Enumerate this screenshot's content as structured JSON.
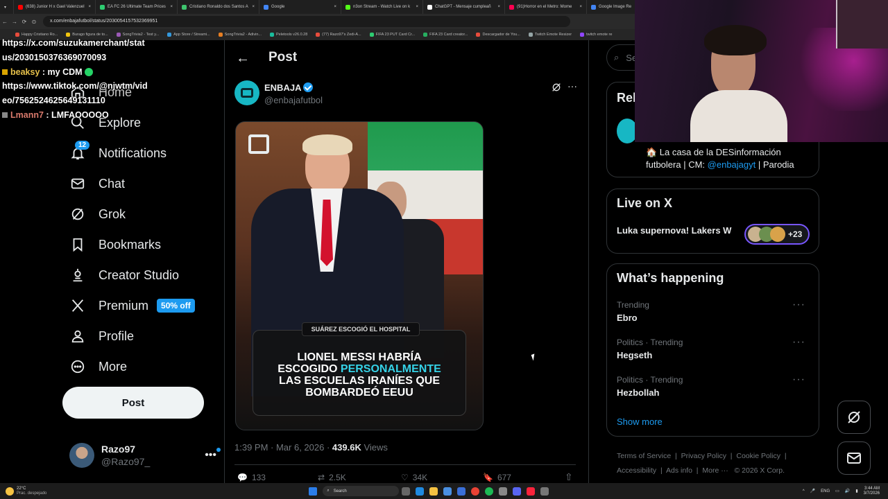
{
  "browser": {
    "tabs": [
      {
        "title": "(638) Junior H x Gael Valenzuel",
        "color": "#ff0000"
      },
      {
        "title": "EA FC 26 Ultimate Team Prices",
        "color": "#2ecc71"
      },
      {
        "title": "Cristiano Ronaldo dos Santos A",
        "color": "#3ec46d"
      },
      {
        "title": "Google",
        "color": "#4285f4"
      },
      {
        "title": "n3on Stream - Watch Live on k",
        "color": "#53fc18"
      },
      {
        "title": "ChatGPT - Mensaje cumpleañ",
        "color": "#ffffff"
      },
      {
        "title": "(91)Horror en el Metro: Mome",
        "color": "#ff0050"
      },
      {
        "title": "Google Image Re",
        "color": "#4285f4"
      }
    ],
    "url": "x.com/enbajafutbol/status/2030054157532369951",
    "bookmarks": [
      "Happy Cristiano Ro...",
      "Burago figura de to...",
      "SongTrivia2 - Test y...",
      "App Store / Streami...",
      "SongTrivia2 - Adivin...",
      "Peletools v26.0.28",
      "(77) Razo97's Zedi-A...",
      "FIFA 23 PUT Card Cr...",
      "FIFA 23 Card creator...",
      "Descargador de You...",
      "Twitch Emote Resizer",
      "twitch emote re"
    ]
  },
  "chat_overlay": [
    {
      "user": "",
      "text": "https://x.com/suzukamerchant/stat"
    },
    {
      "user": "",
      "text": "us/2030150376369070093"
    },
    {
      "user": "beaksy",
      "text": ": my CDM"
    },
    {
      "user": "",
      "text": "https://www.tiktok.com/@njwtm/vid"
    },
    {
      "user": "",
      "text": "eo/7562524625649131110"
    },
    {
      "user": "Lmann7",
      "text": ": LMFAOOOOO"
    }
  ],
  "nav": {
    "home": "Home",
    "explore": "Explore",
    "notifications": "Notifications",
    "notifications_badge": "12",
    "chat": "Chat",
    "grok": "Grok",
    "bookmarks": "Bookmarks",
    "creator_studio": "Creator Studio",
    "premium": "Premium",
    "premium_badge": "50% off",
    "profile": "Profile",
    "more": "More",
    "post_button": "Post",
    "account_name": "Razo97",
    "account_handle": "@Razo97_"
  },
  "post": {
    "header_title": "Post",
    "author_name": "ENBAJA",
    "author_handle": "@enbajafutbol",
    "image_kicker": "SUÁREZ ESCOGIÓ EL HOSPITAL",
    "headline_line1": "LIONEL MESSI HABRÍA",
    "headline_line2_plain": "ESCOGIDO",
    "headline_line2_accent": "PERSONALMENTE",
    "headline_line3": "LAS ESCUELAS IRANÍES QUE",
    "headline_line4": "BOMBARDEÓ EEUU",
    "timestamp": "1:39 PM · Mar 6, 2026 ·",
    "views_count": "439.6K",
    "views_label": "Views",
    "replies": "133",
    "reposts": "2.5K",
    "likes": "34K",
    "bookmarks": "677"
  },
  "sidebar": {
    "search_placeholder": "Se",
    "relevant_title": "Rel",
    "bio_prefix": "🏠 La casa de la DESinformación",
    "bio_line2": "futbolera | CM:",
    "bio_link": "@enbajagyt",
    "bio_suffix": "| Parodia",
    "live_title": "Live on X",
    "live_item": "Luka supernova! Lakers W",
    "live_count": "+23",
    "happening_title": "What’s happening",
    "trends": [
      {
        "category": "Trending",
        "name": "Ebro"
      },
      {
        "category": "Politics · Trending",
        "name": "Hegseth"
      },
      {
        "category": "Politics · Trending",
        "name": "Hezbollah"
      }
    ],
    "show_more": "Show more",
    "footer": [
      "Terms of Service",
      "Privacy Policy",
      "Cookie Policy",
      "Accessibility",
      "Ads info",
      "More ···",
      "© 2026 X Corp."
    ]
  },
  "taskbar": {
    "weather_temp": "22°C",
    "weather_desc": "Prac. despejado",
    "search": "Search",
    "lang": "ENG",
    "time": "3:44 AM",
    "date": "3/7/2026"
  },
  "colors": {
    "accent": "#1d9bf0",
    "headline_accent": "#35d3e8",
    "premium_badge": "#1d9bf0",
    "webcam_glow": "#ff2bd6"
  }
}
